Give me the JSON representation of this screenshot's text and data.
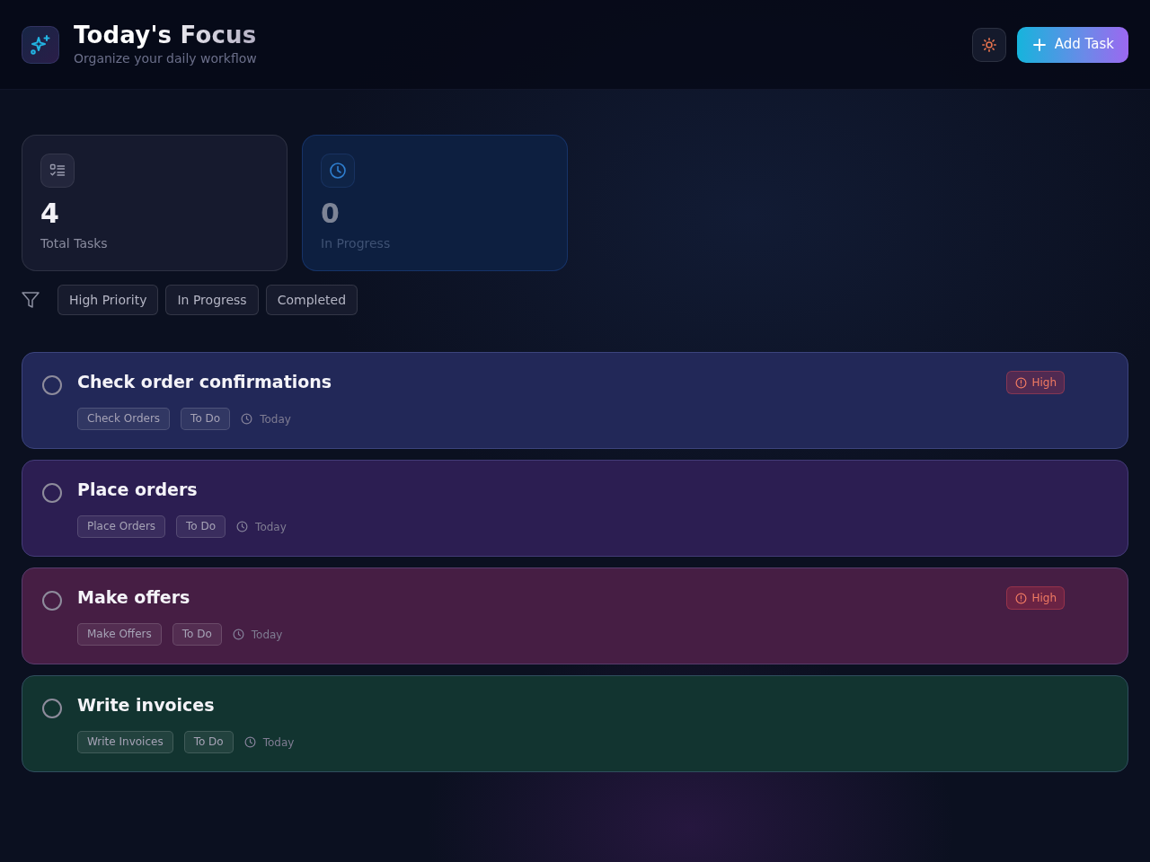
{
  "header": {
    "title": "Today's Focus",
    "subtitle": "Organize your daily workflow",
    "add_button": "Add Task"
  },
  "stats": [
    {
      "kind": "total",
      "value": "4",
      "label": "Total Tasks"
    },
    {
      "kind": "progress",
      "value": "0",
      "label": "In Progress"
    }
  ],
  "filters": [
    {
      "label": "High Priority",
      "selected": false
    },
    {
      "label": "In Progress",
      "selected": false
    },
    {
      "label": "Completed",
      "selected": false
    }
  ],
  "tasks": [
    {
      "title": "Check order confirmations",
      "done": false,
      "color": "#222858",
      "category": "Check Orders",
      "status": "To Do",
      "due": "Today",
      "priority": "High"
    },
    {
      "title": "Place orders",
      "done": false,
      "color": "#2c1e52",
      "category": "Place Orders",
      "status": "To Do",
      "due": "Today"
    },
    {
      "title": "Make offers",
      "done": false,
      "color": "#461e44",
      "category": "Make Offers",
      "status": "To Do",
      "due": "Today",
      "priority": "High"
    },
    {
      "title": "Write invoices",
      "done": false,
      "color": "#123430",
      "category": "Write Invoices",
      "status": "To Do",
      "due": "Today"
    }
  ]
}
